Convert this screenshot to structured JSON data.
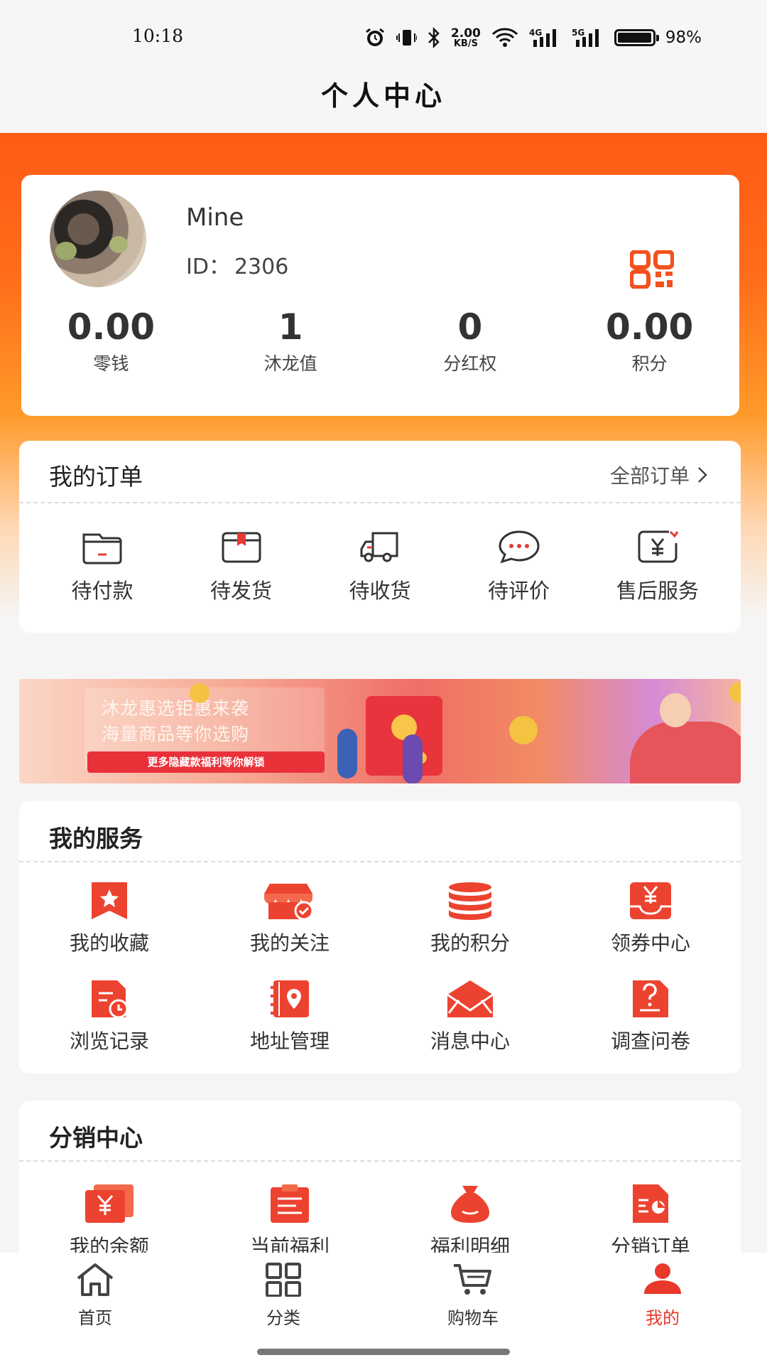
{
  "status_bar": {
    "time": "10:18",
    "net_speed_value": "2.00",
    "net_speed_unit": "KB/S",
    "battery": "98%",
    "signal_4g": "4G",
    "signal_5g": "5G"
  },
  "header": {
    "title": "个人中心"
  },
  "profile": {
    "name": "Mine",
    "id_label": "ID：",
    "id_value": "2306",
    "stats": [
      {
        "value": "0.00",
        "label": "零钱"
      },
      {
        "value": "1",
        "label": "沐龙值"
      },
      {
        "value": "0",
        "label": "分红权"
      },
      {
        "value": "0.00",
        "label": "积分"
      }
    ]
  },
  "orders": {
    "title": "我的订单",
    "all_link": "全部订单",
    "items": [
      {
        "label": "待付款",
        "icon": "wallet-icon"
      },
      {
        "label": "待发货",
        "icon": "package-box-icon"
      },
      {
        "label": "待收货",
        "icon": "delivery-truck-icon"
      },
      {
        "label": "待评价",
        "icon": "chat-bubble-icon"
      },
      {
        "label": "售后服务",
        "icon": "refund-yen-icon"
      }
    ]
  },
  "banner": {
    "line1": "沐龙惠选钜惠来袭",
    "line2": "海量商品等你选购",
    "tag": "更多隐藏款福利等你解锁"
  },
  "services": {
    "title": "我的服务",
    "items": [
      {
        "label": "我的收藏",
        "icon": "star-bookmark-icon"
      },
      {
        "label": "我的关注",
        "icon": "store-check-icon"
      },
      {
        "label": "我的积分",
        "icon": "coin-stack-icon"
      },
      {
        "label": "领券中心",
        "icon": "yen-coupon-icon"
      },
      {
        "label": "浏览记录",
        "icon": "history-doc-icon"
      },
      {
        "label": "地址管理",
        "icon": "address-book-icon"
      },
      {
        "label": "消息中心",
        "icon": "envelope-icon"
      },
      {
        "label": "调查问卷",
        "icon": "questionnaire-icon"
      }
    ]
  },
  "distribution": {
    "title": "分销中心",
    "items": [
      {
        "label": "我的余额",
        "icon": "balance-yen-icon"
      },
      {
        "label": "当前福利",
        "icon": "clipboard-icon"
      },
      {
        "label": "福利明细",
        "icon": "money-bag-icon"
      },
      {
        "label": "分销订单",
        "icon": "order-chart-icon"
      }
    ]
  },
  "tabbar": {
    "items": [
      {
        "label": "首页",
        "icon": "home-icon"
      },
      {
        "label": "分类",
        "icon": "grid-icon"
      },
      {
        "label": "购物车",
        "icon": "cart-icon"
      },
      {
        "label": "我的",
        "icon": "person-icon"
      }
    ],
    "active_index": 3
  },
  "colors": {
    "brand_orange": "#ff5a14",
    "icon_red": "#ec4330",
    "active_tab": "#e8392a"
  }
}
